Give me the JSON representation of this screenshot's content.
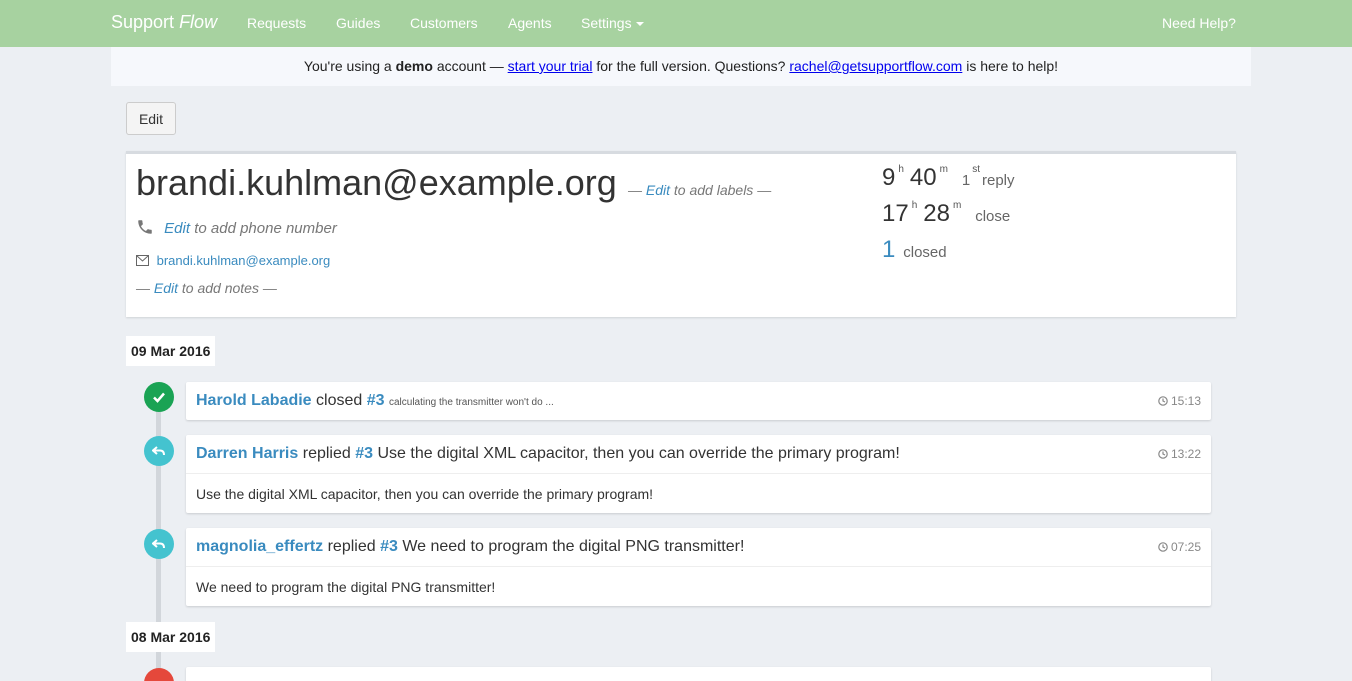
{
  "nav": {
    "brand_main": "Support",
    "brand_italic": "Flow",
    "items": [
      "Requests",
      "Guides",
      "Customers",
      "Agents",
      "Settings"
    ],
    "help": "Need Help?"
  },
  "demo": {
    "prefix": "You're using a",
    "bold": "demo",
    "mid1": "account —",
    "trial_link": "start your trial",
    "mid2": "for the full version. Questions?",
    "email_link": "rachel@getsupportflow.com",
    "suffix": "is here to help!"
  },
  "edit_button": "Edit",
  "customer": {
    "email_title": "brandi.kuhlman@example.org",
    "labels_dash_l": "—",
    "labels_edit": "Edit",
    "labels_text": "to add labels —",
    "phone_edit": "Edit",
    "phone_text": "to add phone number",
    "email": "brandi.kuhlman@example.org",
    "notes_dash": "—",
    "notes_edit": "Edit",
    "notes_text": "to add notes —"
  },
  "stats": {
    "reply_h": "9",
    "reply_h_unit": "h",
    "reply_m": "40",
    "reply_m_unit": "m",
    "reply_ord_num": "1",
    "reply_ord_sup": "st",
    "reply_label": "reply",
    "close_h": "17",
    "close_h_unit": "h",
    "close_m": "28",
    "close_m_unit": "m",
    "close_label": "close",
    "closed_count": "1",
    "closed_label": "closed"
  },
  "timeline": {
    "date1": "09 Mar 2016",
    "date2": "08 Mar 2016",
    "events": [
      {
        "author": "Harold Labadie",
        "action": "closed",
        "ticket": "#3",
        "summary": "calculating the transmitter won't do ...",
        "time": "15:13"
      },
      {
        "author": "Darren Harris",
        "action": "replied",
        "ticket": "#3",
        "summary": "Use the digital XML capacitor, then you can override the primary program!",
        "time": "13:22",
        "body": "Use the digital XML capacitor, then you can override the primary program!"
      },
      {
        "author": "magnolia_effertz",
        "action": "replied",
        "ticket": "#3",
        "summary": "We need to program the digital PNG transmitter!",
        "time": "07:25",
        "body": "We need to program the digital PNG transmitter!"
      }
    ]
  },
  "icons": {
    "check": "check-icon",
    "reply": "reply-icon",
    "phone": "phone-icon",
    "envelope": "envelope-icon",
    "clock": "clock-icon"
  },
  "colors": {
    "navbar": "#a7d2a0",
    "link": "#3a8bbf",
    "closed_circle": "#1aa354",
    "reply_circle": "#44c3cf",
    "red_circle": "#e5483b"
  }
}
